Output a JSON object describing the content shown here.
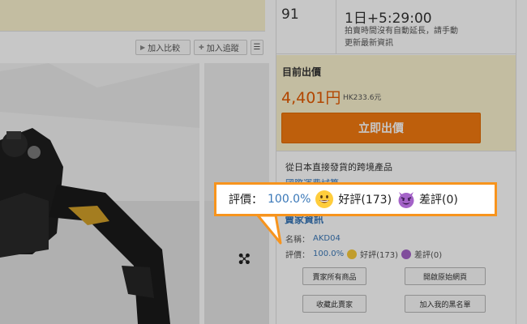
{
  "toolbar": {
    "compare_label": "加入比較",
    "track_label": "加入追蹤",
    "more_label": "☰"
  },
  "auction": {
    "bids": "91",
    "time_left": "1日+5:29:00",
    "time_note": "拍賣時間沒有自動延長，請手動更新最新資訊"
  },
  "bid_panel": {
    "title": "目前出價",
    "price": "4,401円",
    "price_hkd": "HK233.6元",
    "bid_button": "立即出價"
  },
  "shipping": {
    "note": "從日本直接發貨的跨境產品",
    "link": "國際運費試算"
  },
  "seller": {
    "title": "賣家資訊",
    "name_label": "名稱：",
    "name_value": "AKD04",
    "rating_label": "評價：",
    "rating_percent": "100.0%",
    "good_label": "好評(173)",
    "bad_label": "差評(0)",
    "buttons": {
      "all_items": "賣家所有商品",
      "open_page": "開啟原始網頁",
      "favorite": "收藏此賣家",
      "blacklist": "加入我的黑名單"
    }
  },
  "callout": {
    "rating_label": "評價：",
    "rating_percent": "100.0%",
    "good_label": "好評(173)",
    "bad_label": "差評(0)"
  },
  "icons": {
    "compare": "play-icon",
    "track": "plus-icon",
    "more": "menu-icon",
    "good": "grinning-face-icon",
    "bad": "devil-face-icon",
    "gallery_next": "arrow-icon"
  },
  "colors": {
    "accent_orange": "#f47a10",
    "price_orange": "#e55a00",
    "link_blue": "#3a78b8",
    "highlight_yellow": "#faf2cf",
    "callout_border": "#f7941d"
  }
}
